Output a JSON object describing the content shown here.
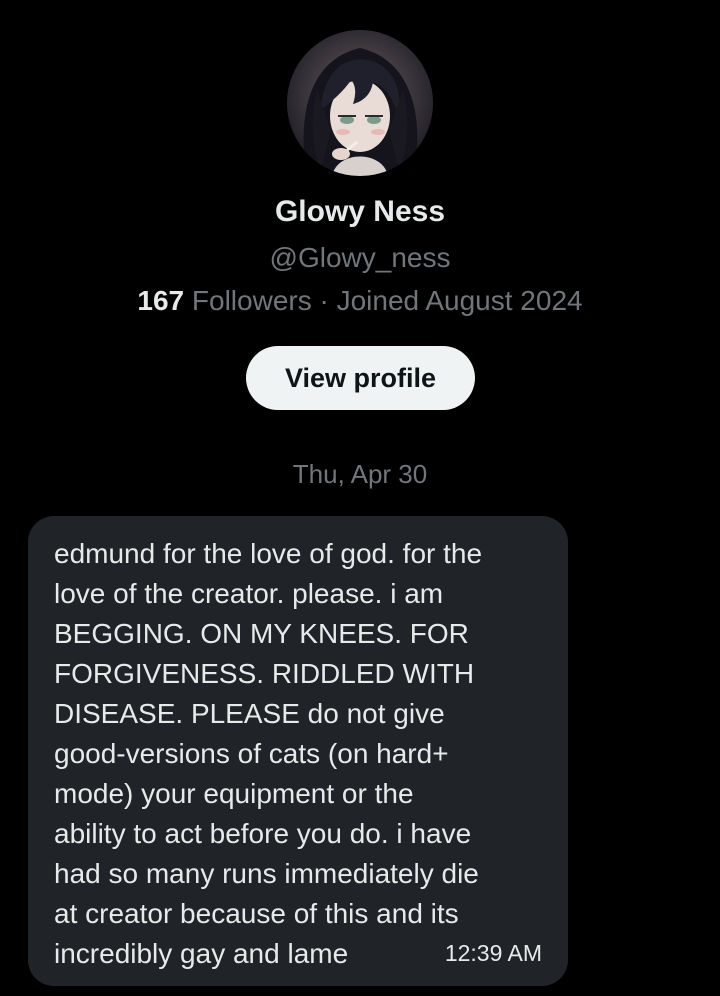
{
  "profile": {
    "display_name": "Glowy Ness",
    "handle": "@Glowy_ness",
    "followers_count": "167",
    "followers_label": "Followers",
    "separator": "·",
    "joined": "Joined August 2024",
    "view_profile_label": "View profile"
  },
  "conversation": {
    "date_separator": "Thu, Apr 30",
    "messages": [
      {
        "text": "edmund for the love of god. for the\nlove of the creator. please. i am\nBEGGING. ON MY KNEES. FOR\nFORGIVENESS. RIDDLED WITH\nDISEASE. PLEASE do not give\ngood-versions of cats (on hard+\nmode) your equipment or the\nability to act before you do. i have\nhad so many runs immediately die\nat creator because of this and its\nincredibly gay and lame",
        "time": "12:39 AM"
      }
    ]
  },
  "colors": {
    "background": "#000000",
    "primary_text": "#e7e9ea",
    "secondary_text": "#71767b",
    "bubble": "#202327",
    "button_bg": "#eff3f4",
    "button_text": "#0f1419"
  }
}
